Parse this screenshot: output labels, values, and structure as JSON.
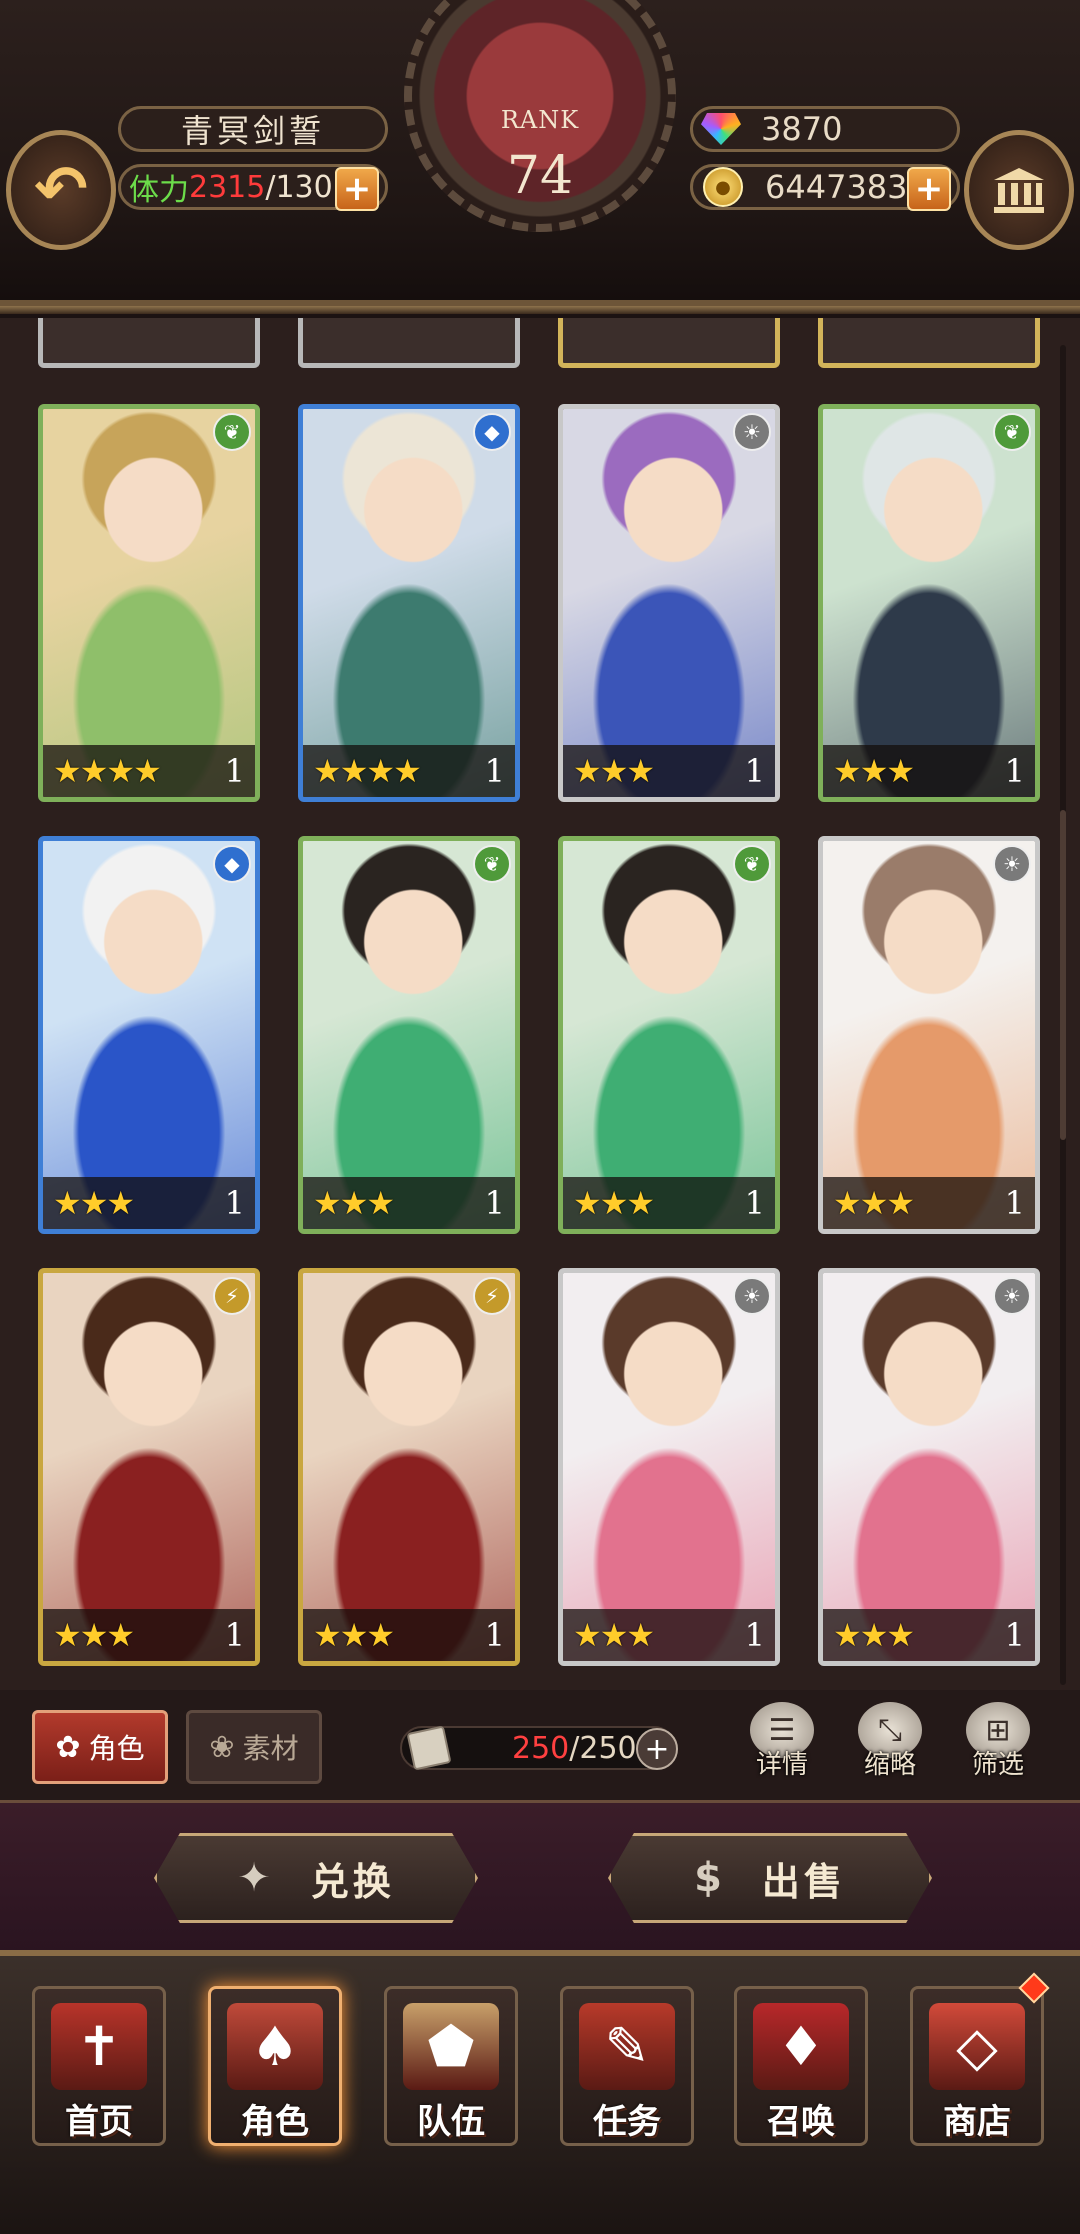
{
  "header": {
    "player_name": "青冥剑誓",
    "stamina_label": "体力",
    "stamina_current": "2315",
    "stamina_max": "/130",
    "rank_label": "RANK",
    "rank_value": "74",
    "gems": "3870",
    "gold": "6447383",
    "plus": "+"
  },
  "cards": [
    {
      "element": "nature",
      "stars": "★★★★",
      "level": "1",
      "art_colors": [
        "#e7d3a0",
        "#8fbf6a",
        "#c7a45a"
      ]
    },
    {
      "element": "water",
      "stars": "★★★★",
      "level": "1",
      "art_colors": [
        "#cfdbe8",
        "#3d7b6f",
        "#ece5d6"
      ]
    },
    {
      "element": "light",
      "stars": "★★★",
      "level": "1",
      "art_colors": [
        "#d8d8e4",
        "#3b55b8",
        "#9b6bbf"
      ]
    },
    {
      "element": "nature",
      "stars": "★★★",
      "level": "1",
      "art_colors": [
        "#cde2cf",
        "#2e3a4a",
        "#dfe6e6"
      ]
    },
    {
      "element": "water",
      "stars": "★★★",
      "level": "1",
      "art_colors": [
        "#cfe2f4",
        "#2a55c8",
        "#f2f2f2"
      ]
    },
    {
      "element": "nature",
      "stars": "★★★",
      "level": "1",
      "art_colors": [
        "#d6e7d4",
        "#3fae73",
        "#2a2420"
      ]
    },
    {
      "element": "nature",
      "stars": "★★★",
      "level": "1",
      "art_colors": [
        "#d6e7d4",
        "#3fae73",
        "#2a2420"
      ]
    },
    {
      "element": "light",
      "stars": "★★★",
      "level": "1",
      "art_colors": [
        "#f4f1ee",
        "#e59a6a",
        "#9a7c6a"
      ]
    },
    {
      "element": "thunder",
      "stars": "★★★",
      "level": "1",
      "art_colors": [
        "#e9d4c0",
        "#8a2020",
        "#4a2a1a"
      ]
    },
    {
      "element": "thunder",
      "stars": "★★★",
      "level": "1",
      "art_colors": [
        "#e9d4c0",
        "#8a2020",
        "#4a2a1a"
      ]
    },
    {
      "element": "light",
      "stars": "★★★",
      "level": "1",
      "art_colors": [
        "#f2eef0",
        "#e2728e",
        "#5a3a2a"
      ]
    },
    {
      "element": "light",
      "stars": "★★★",
      "level": "1",
      "art_colors": [
        "#f2eef0",
        "#e2728e",
        "#5a3a2a"
      ]
    }
  ],
  "toolbar": {
    "tab_character": "角色",
    "tab_material": "素材",
    "capacity_current": "250",
    "capacity_max": "/250",
    "capacity_plus": "+",
    "detail_label": "详情",
    "thumbnail_label": "缩略",
    "filter_label": "筛选"
  },
  "actions": {
    "exchange_label": "兑换",
    "sell_label": "出售"
  },
  "nav": {
    "items": [
      {
        "label": "首页",
        "icon": "home-banner-icon",
        "color": "#b8342a"
      },
      {
        "label": "角色",
        "icon": "character-card-icon",
        "color": "#c04a3a"
      },
      {
        "label": "队伍",
        "icon": "team-emblem-icon",
        "color": "#c8a06a"
      },
      {
        "label": "任务",
        "icon": "quest-book-icon",
        "color": "#b83a2a"
      },
      {
        "label": "召唤",
        "icon": "summon-card-icon",
        "color": "#b8282a"
      },
      {
        "label": "商店",
        "icon": "shop-gem-icon",
        "color": "#d24a3a"
      }
    ]
  }
}
